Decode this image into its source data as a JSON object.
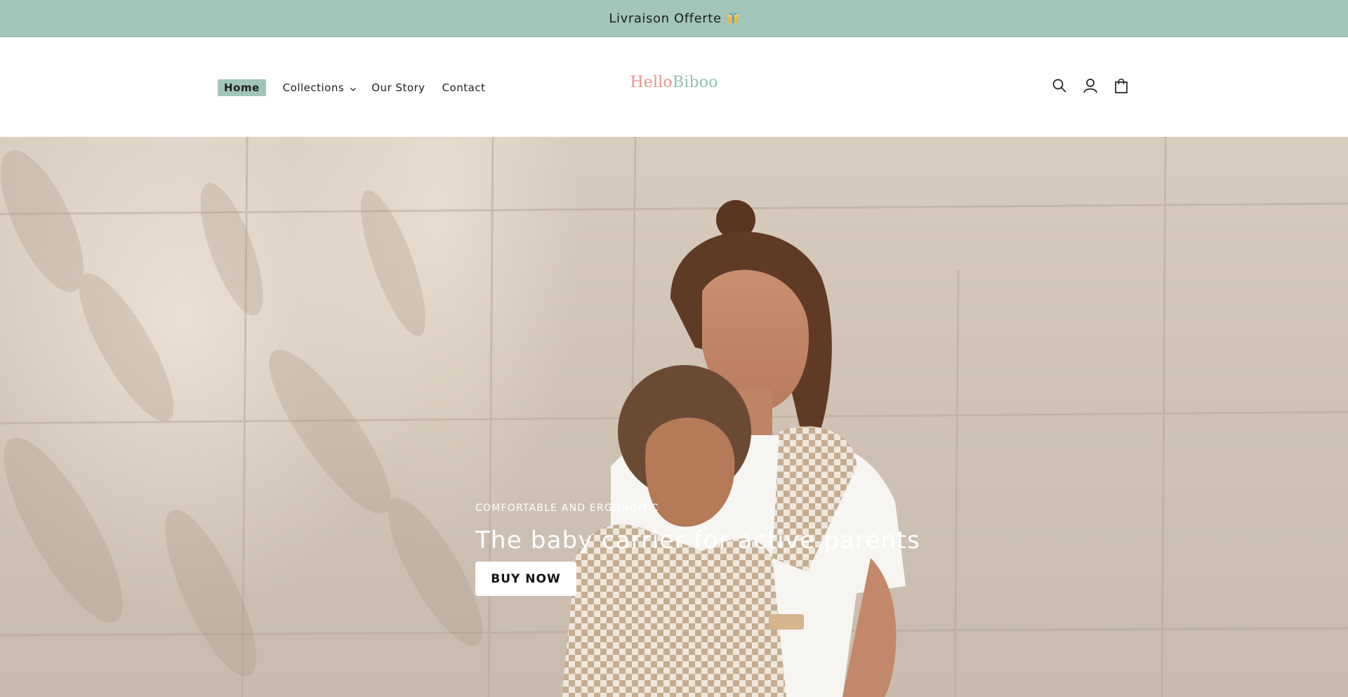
{
  "announcement": {
    "text": "Livraison Offerte",
    "icon": "gift-icon"
  },
  "nav": {
    "home": "Home",
    "collections": "Collections",
    "our_story": "Our Story",
    "contact": "Contact"
  },
  "logo": {
    "part1": "Hello",
    "part2": "Biboo"
  },
  "icons": {
    "search": "search-icon",
    "account": "account-icon",
    "cart": "cart-icon"
  },
  "hero": {
    "eyebrow": "COMFORTABLE AND ERGONOMIC",
    "title": "The baby carrier for active parents",
    "button": "BUY NOW"
  },
  "colors": {
    "accent": "#a2c5b7",
    "logo_pink": "#e8958b",
    "logo_green": "#8fc2b3"
  }
}
